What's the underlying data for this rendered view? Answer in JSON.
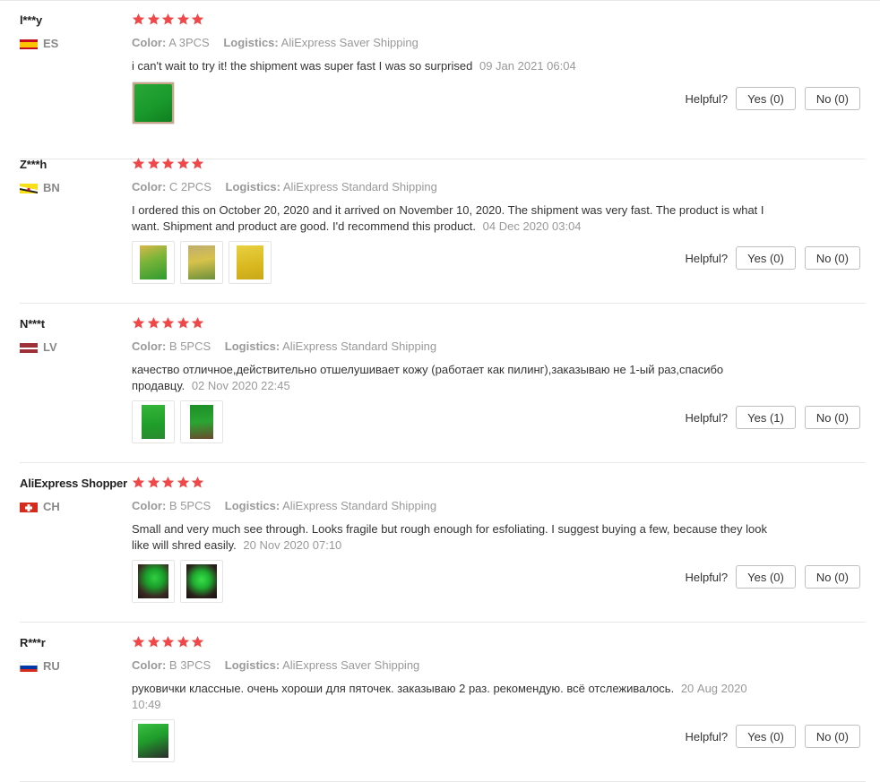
{
  "helpful_label": "Helpful?",
  "colors": {
    "star": "#f04848",
    "muted": "#999999"
  },
  "reviews": [
    {
      "user": "l***y",
      "country_code": "ES",
      "flag": "spain",
      "stars": 5,
      "color_label": "Color:",
      "color_value": "A 3PCS",
      "logistics_label": "Logistics:",
      "logistics_value": "AliExpress Saver Shipping",
      "text": "i can't wait to try it! the shipment was super fast I was so surprised",
      "date": "09 Jan 2021 06:04",
      "photos": 1,
      "yes": "Yes (0)",
      "no": "No (0)"
    },
    {
      "user": "Z***h",
      "country_code": "BN",
      "flag": "brunei",
      "stars": 5,
      "color_label": "Color:",
      "color_value": "C 2PCS",
      "logistics_label": "Logistics:",
      "logistics_value": "AliExpress Standard Shipping",
      "text": "I ordered this on October 20, 2020 and it arrived on November 10, 2020. The shipment was very fast. The product is what I want. Shipment and product are good. I'd recommend this product.",
      "date": "04 Dec 2020 03:04",
      "photos": 3,
      "yes": "Yes (0)",
      "no": "No (0)"
    },
    {
      "user": "N***t",
      "country_code": "LV",
      "flag": "latvia",
      "stars": 5,
      "color_label": "Color:",
      "color_value": "B 5PCS",
      "logistics_label": "Logistics:",
      "logistics_value": "AliExpress Standard Shipping",
      "text": "качество отличное,действительно отшелушивает кожу (работает как пилинг),заказываю не 1-ый раз,спасибо продавцу.",
      "date": "02 Nov 2020 22:45",
      "photos": 2,
      "yes": "Yes (1)",
      "no": "No (0)"
    },
    {
      "user": "AliExpress Shopper",
      "country_code": "CH",
      "flag": "switzerland",
      "stars": 5,
      "color_label": "Color:",
      "color_value": "B 5PCS",
      "logistics_label": "Logistics:",
      "logistics_value": "AliExpress Standard Shipping",
      "text": "Small and very much see through. Looks fragile but rough enough for esfoliating. I suggest buying a few, because they look like will shred easily.",
      "date": "20 Nov 2020 07:10",
      "photos": 2,
      "yes": "Yes (0)",
      "no": "No (0)"
    },
    {
      "user": "R***r",
      "country_code": "RU",
      "flag": "russia",
      "stars": 5,
      "color_label": "Color:",
      "color_value": "B 3PCS",
      "logistics_label": "Logistics:",
      "logistics_value": "AliExpress Saver Shipping",
      "text": "руковички классные. очень хороши для пяточек. заказываю 2 раз. рекомендую. всё отслеживалось.",
      "date": "20 Aug 2020 10:49",
      "photos": 1,
      "yes": "Yes (0)",
      "no": "No (0)"
    }
  ]
}
